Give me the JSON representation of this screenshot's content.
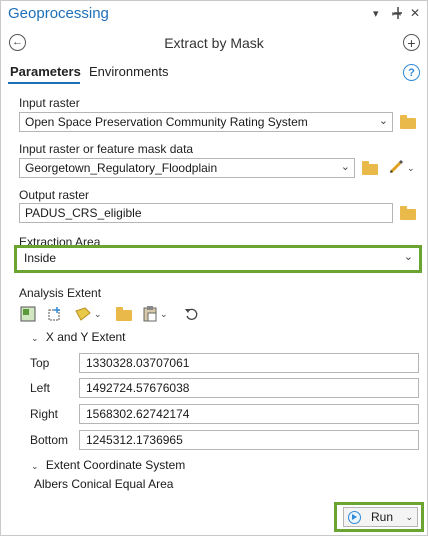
{
  "window": {
    "title": "Geoprocessing",
    "controls": [
      "chevron-down-icon",
      "pin-icon",
      "close-icon"
    ]
  },
  "header": {
    "back_icon": "back-arrow-icon",
    "tool_title": "Extract by Mask",
    "add_icon": "add-icon"
  },
  "tabs": [
    {
      "label": "Parameters",
      "active": true
    },
    {
      "label": "Environments",
      "active": false
    }
  ],
  "help_icon": "?",
  "params": {
    "input_raster": {
      "label": "Input raster",
      "value": "Open Space Preservation Community Rating System"
    },
    "mask": {
      "label": "Input raster or feature mask data",
      "value": "Georgetown_Regulatory_Floodplain"
    },
    "output": {
      "label": "Output raster",
      "value": "PADUS_CRS_eligible"
    },
    "extraction": {
      "label": "Extraction Area",
      "value": "Inside"
    }
  },
  "analysis_extent": {
    "label": "Analysis Extent",
    "xy_section": "X and Y Extent",
    "top_label": "Top",
    "top_value": "1330328.03707061",
    "left_label": "Left",
    "left_value": "1492724.57676038",
    "right_label": "Right",
    "right_value": "1568302.62742174",
    "bottom_label": "Bottom",
    "bottom_value": "1245312.1736965",
    "coord_section": "Extent Coordinate System",
    "coord_value": "Albers Conical Equal Area"
  },
  "run_button": {
    "label": "Run"
  },
  "colors": {
    "accent": "#1e6fb8",
    "highlight": "#6aa431",
    "folder": "#e9b949"
  }
}
